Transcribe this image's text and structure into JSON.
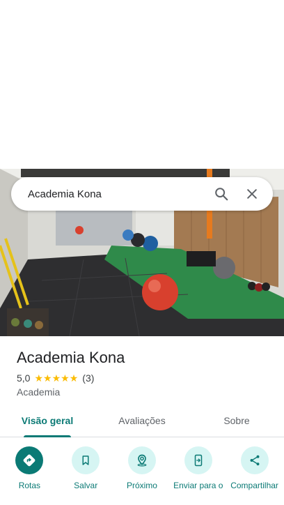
{
  "search": {
    "query": "Academia Kona"
  },
  "place": {
    "name": "Academia Kona",
    "rating": "5,0",
    "stars": 5,
    "reviews": "(3)",
    "category": "Academia"
  },
  "tabs": [
    {
      "label": "Visão geral",
      "active": true
    },
    {
      "label": "Avaliações",
      "active": false
    },
    {
      "label": "Sobre",
      "active": false
    }
  ],
  "actions": [
    {
      "label": "Rotas",
      "icon": "directions-icon"
    },
    {
      "label": "Salvar",
      "icon": "bookmark-icon"
    },
    {
      "label": "Próximo",
      "icon": "nearby-icon"
    },
    {
      "label": "Enviar para o",
      "icon": "send-to-phone-icon"
    },
    {
      "label": "Compartilhar",
      "icon": "share-icon"
    }
  ],
  "colors": {
    "accent": "#0b7a75",
    "accent_light": "#d6f5f3",
    "star": "#fbbc04"
  }
}
